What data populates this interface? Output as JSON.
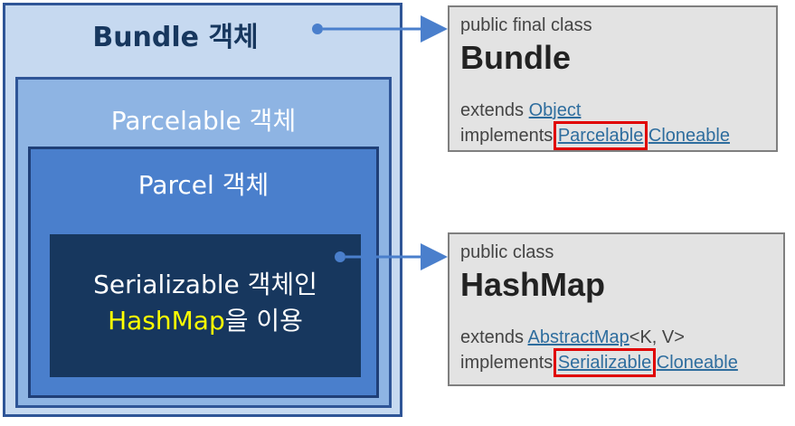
{
  "diagram": {
    "bundle_label": "Bundle 객체",
    "parcelable_label": "Parcelable 객체",
    "parcel_label": "Parcel 객체",
    "inner_line1": "Serializable 객체인",
    "inner_highlight": "HashMap",
    "inner_line2_rest": "을 이용"
  },
  "bundle_card": {
    "modifiers": "public final class",
    "name": "Bundle",
    "extends_kw": "extends",
    "extends_link": "Object",
    "implements_kw": "implements",
    "impl_link1": "Parcelable",
    "impl_link2": "Cloneable"
  },
  "hashmap_card": {
    "modifiers": "public class",
    "name": "HashMap",
    "extends_kw": "extends",
    "extends_link": "AbstractMap",
    "extends_generic": "<K, V>",
    "implements_kw": "implements",
    "impl_link1": "Serializable",
    "impl_link2": "Cloneable"
  },
  "colors": {
    "outer_fill": "#c6d9f0",
    "mid_fill": "#8eb4e3",
    "parcel_fill": "#4a7fcc",
    "inner_fill": "#17375e",
    "highlight_text": "#ffff00",
    "callout_red": "#e00000",
    "arrow": "#4a7fcc"
  }
}
